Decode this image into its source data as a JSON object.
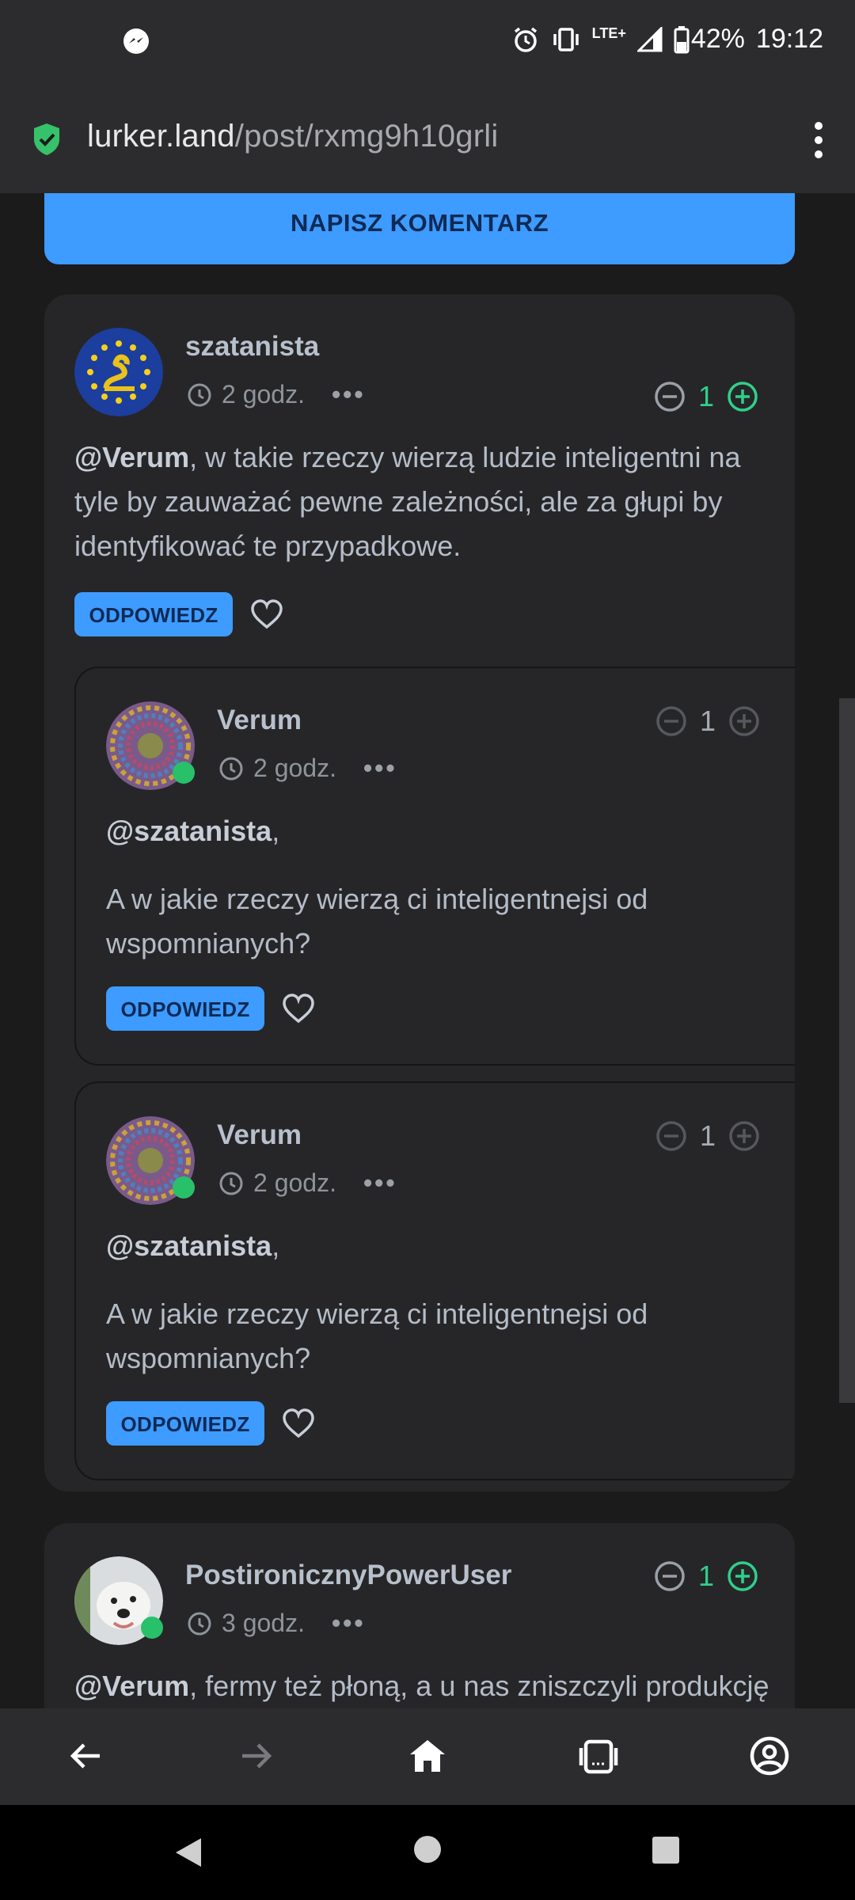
{
  "status_bar": {
    "battery": "42%",
    "time": "19:12",
    "network": "LTE+"
  },
  "url_bar": {
    "domain": "lurker.land",
    "path": "/post/rxmg9h10grli"
  },
  "write_comment_button": "NAPISZ KOMENTARZ",
  "comments": [
    {
      "author": "szatanista",
      "time": "2 godz.",
      "more": "•••",
      "score": "1",
      "mention": "@Verum",
      "text": ", w takie rzeczy wierzą ludzie inteligentni na tyle by zauważać pewne zależności, ale za głupi by identyfikować te przypadkowe.",
      "reply_label": "ODPOWIEDZ"
    },
    {
      "author": "Verum",
      "time": "2 godz.",
      "more": "•••",
      "score": "1",
      "mention": "@szatanista",
      "mention_suffix": ",",
      "text": "A w jakie rzeczy wierzą ci inteligentnejsi od wspomnianych?",
      "reply_label": "ODPOWIEDZ"
    },
    {
      "author": "Verum",
      "time": "2 godz.",
      "more": "•••",
      "score": "1",
      "mention": "@szatanista",
      "mention_suffix": ",",
      "text": "A w jakie rzeczy wierzą ci inteligentnejsi od wspomnianych?",
      "reply_label": "ODPOWIEDZ"
    },
    {
      "author": "PostironicznyPowerUser",
      "time": "3 godz.",
      "more": "•••",
      "score": "1",
      "mention": "@Verum",
      "text": ", fermy też płoną, a u nas zniszczyli produkcję"
    }
  ],
  "colors": {
    "accent": "#3e9bff",
    "upvote": "#2fd08a",
    "online": "#29c06a",
    "card": "#262628"
  },
  "icons": {
    "bottom_nav": [
      "back-arrow-icon",
      "forward-arrow-icon",
      "home-icon",
      "tabs-icon",
      "account-icon"
    ]
  }
}
